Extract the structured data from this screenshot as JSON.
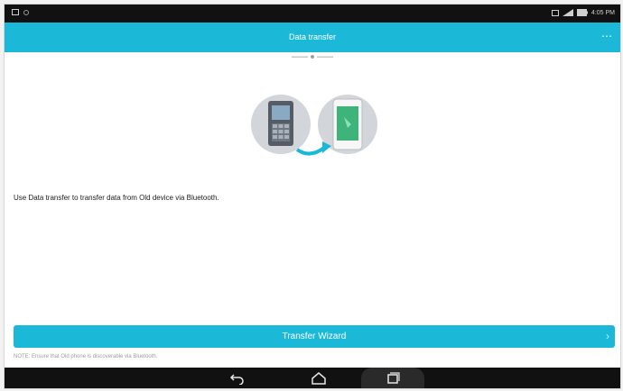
{
  "statusbar": {
    "time": "4:05 PM"
  },
  "appbar": {
    "title": "Data transfer",
    "overflow": "⋯"
  },
  "main": {
    "description": "Use Data transfer to transfer data from Old device via Bluetooth."
  },
  "wizard": {
    "label": "Transfer Wizard",
    "chevron": "›"
  },
  "note": {
    "text": "NOTE: Ensure that Old phone is discoverable via Bluetooth."
  },
  "colors": {
    "accent": "#1bb8d8",
    "statusbar": "#111111"
  },
  "icons": {
    "status": [
      "notification-icon",
      "settings-icon",
      "sim-icon",
      "signal-icon",
      "battery-icon"
    ],
    "hero": [
      "old-phone-icon",
      "arrow-icon",
      "new-phone-icon"
    ],
    "nav": [
      "back-icon",
      "home-icon",
      "recents-icon"
    ]
  }
}
